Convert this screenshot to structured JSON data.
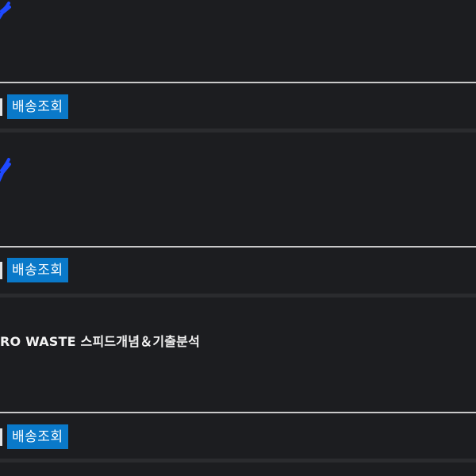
{
  "orders": [
    {
      "product_title": "",
      "track_button_label": "배송조회",
      "has_image_mark": true
    },
    {
      "product_title": "",
      "track_button_label": "배송조회",
      "has_image_mark": true
    },
    {
      "product_title": "RO WASTE 스피드개념＆기출분석",
      "track_button_label": "배송조회",
      "has_image_mark": false
    }
  ],
  "colors": {
    "background": "#1a1b1d",
    "button": "#0a79c9",
    "mark": "#1e49ff",
    "divider_line": "#c9c9c9"
  }
}
